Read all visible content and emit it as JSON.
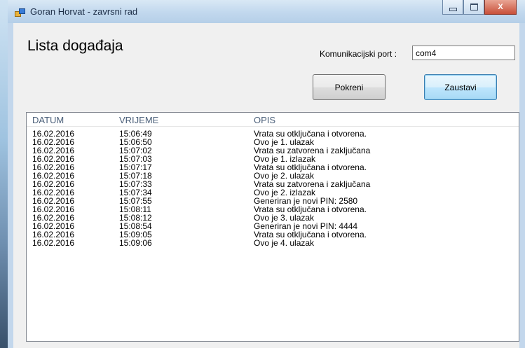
{
  "window": {
    "title": "Goran Horvat - zavrsni rad",
    "close_glyph": "X"
  },
  "page": {
    "title": "Lista događaja"
  },
  "port": {
    "label": "Komunikacijski port :",
    "value": "com4"
  },
  "buttons": {
    "start": "Pokreni",
    "stop": "Zaustavi"
  },
  "list": {
    "columns": [
      "DATUM",
      "VRIJEME",
      "OPIS"
    ],
    "rows": [
      [
        "16.02.2016",
        "15:06:49",
        "Vrata su otključana i otvorena."
      ],
      [
        "16.02.2016",
        "15:06:50",
        "Ovo je 1. ulazak"
      ],
      [
        "16.02.2016",
        "15:07:02",
        "Vrata su zatvorena i zaključana"
      ],
      [
        "16.02.2016",
        "15:07:03",
        "Ovo je 1. izlazak"
      ],
      [
        "16.02.2016",
        "15:07:17",
        "Vrata su otključana i otvorena."
      ],
      [
        "16.02.2016",
        "15:07:18",
        "Ovo je 2. ulazak"
      ],
      [
        "16.02.2016",
        "15:07:33",
        "Vrata su zatvorena i zaključana"
      ],
      [
        "16.02.2016",
        "15:07:34",
        "Ovo je 2. izlazak"
      ],
      [
        "16.02.2016",
        "15:07:55",
        "Generiran je novi PIN: 2580"
      ],
      [
        "16.02.2016",
        "15:08:11",
        "Vrata su otključana i otvorena."
      ],
      [
        "16.02.2016",
        "15:08:12",
        "Ovo je 3. ulazak"
      ],
      [
        "16.02.2016",
        "15:08:54",
        "Generiran je novi PIN: 4444"
      ],
      [
        "16.02.2016",
        "15:09:05",
        "Vrata su otključana i otvorena."
      ],
      [
        "16.02.2016",
        "15:09:06",
        "Ovo je 4. ulazak"
      ]
    ]
  },
  "colors": {
    "titlebar": "#c3d9ee",
    "header_text": "#4c607a",
    "stop_button": "#bee6fd"
  }
}
